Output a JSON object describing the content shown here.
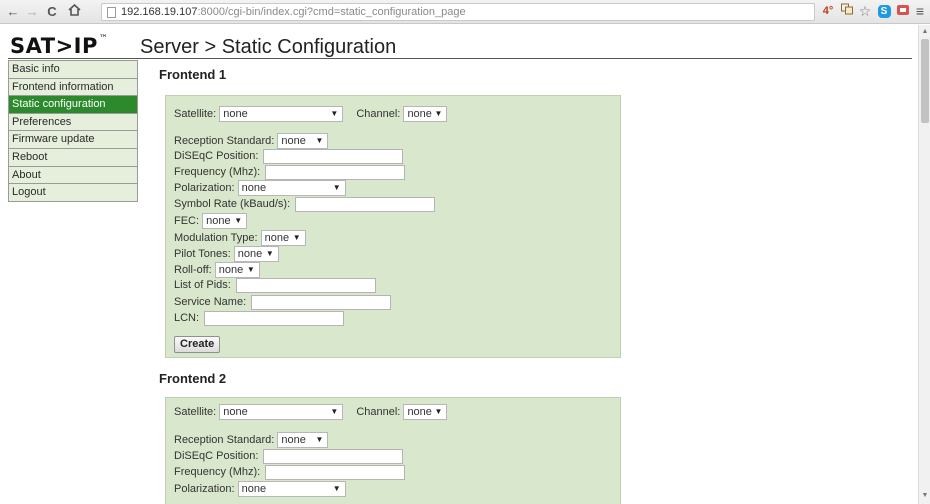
{
  "browser": {
    "back_icon": "←",
    "forward_icon": "→",
    "reload_icon": "C",
    "home_icon": "ñ",
    "url_host": "192.168.19.107",
    "url_rest": ":8000/cgi-bin/index.cgi?cmd=static_configuration_page",
    "ext_temp": "4°",
    "ext_icons": [
      "translate-icon",
      "star-icon",
      "skype-icon",
      "extension-icon",
      "menu-icon"
    ],
    "ext_star": "☆",
    "ext_skype": "S",
    "ext_menu": "≡"
  },
  "header": {
    "logo_text": "SAT>IP",
    "logo_tm": "™",
    "title": "Server > Static Configuration"
  },
  "sidebar": {
    "items": [
      {
        "label": "Basic info",
        "active": false
      },
      {
        "label": "Frontend information",
        "active": false
      },
      {
        "label": "Static configuration",
        "active": true
      },
      {
        "label": "Preferences",
        "active": false
      },
      {
        "label": "Firmware update",
        "active": false
      },
      {
        "label": "Reboot",
        "active": false
      },
      {
        "label": "About",
        "active": false
      },
      {
        "label": "Logout",
        "active": false
      }
    ]
  },
  "frontends": [
    {
      "title": "Frontend 1",
      "satellite_label": "Satellite:",
      "satellite_value": "none",
      "channel_label": "Channel:",
      "channel_value": "none",
      "reception_label": "Reception Standard:",
      "reception_value": "none",
      "diseqc_label": "DiSEqC Position:",
      "diseqc_value": "",
      "frequency_label": "Frequency (Mhz):",
      "frequency_value": "",
      "polarization_label": "Polarization:",
      "polarization_value": "none",
      "symbol_rate_label": "Symbol Rate (kBaud/s):",
      "symbol_rate_value": "",
      "fec_label": "FEC:",
      "fec_value": "none",
      "modulation_label": "Modulation Type:",
      "modulation_value": "none",
      "pilot_label": "Pilot Tones:",
      "pilot_value": "none",
      "rolloff_label": "Roll-off:",
      "rolloff_value": "none",
      "pids_label": "List of Pids:",
      "pids_value": "",
      "service_label": "Service Name:",
      "service_value": "",
      "lcn_label": "LCN:",
      "lcn_value": "",
      "create_label": "Create"
    },
    {
      "title": "Frontend 2",
      "satellite_label": "Satellite:",
      "satellite_value": "none",
      "channel_label": "Channel:",
      "channel_value": "none",
      "reception_label": "Reception Standard:",
      "reception_value": "none",
      "diseqc_label": "DiSEqC Position:",
      "diseqc_value": "",
      "frequency_label": "Frequency (Mhz):",
      "frequency_value": "",
      "polarization_label": "Polarization:",
      "polarization_value": "none"
    }
  ],
  "caret": "▼"
}
